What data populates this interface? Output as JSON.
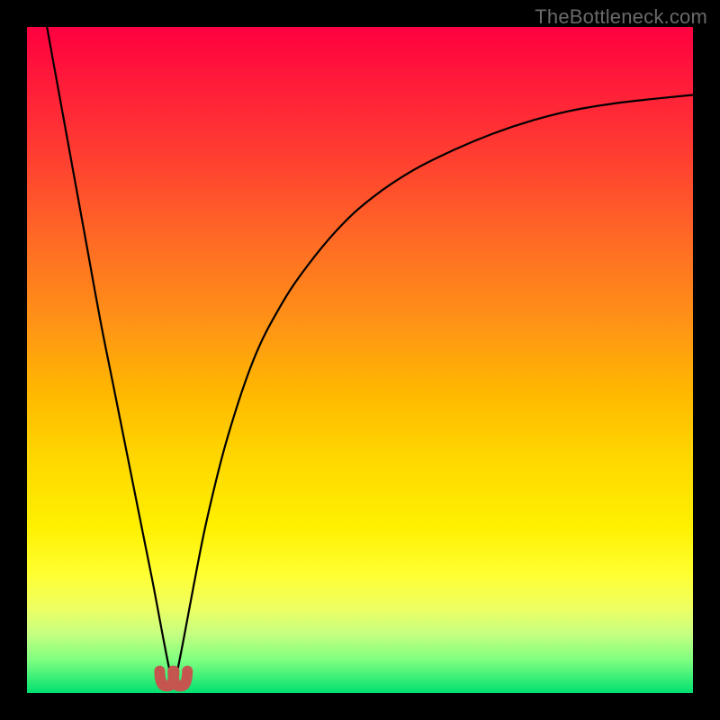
{
  "watermark": "TheBottleneck.com",
  "colors": {
    "frame": "#000000",
    "curve": "#000000",
    "marker_fill": "#c4564f",
    "marker_outline": "#c4564f"
  },
  "chart_data": {
    "type": "line",
    "title": "",
    "xlabel": "",
    "ylabel": "",
    "xlim": [
      0,
      100
    ],
    "ylim": [
      0,
      100
    ],
    "grid": false,
    "legend": false,
    "optimum_x": 22,
    "series": [
      {
        "name": "bottleneck-curve",
        "x": [
          3,
          5,
          7,
          9,
          11,
          13,
          15,
          17,
          19,
          20.5,
          21.5,
          22,
          22.5,
          23.5,
          25,
          27,
          30,
          34,
          38,
          42,
          47,
          52,
          58,
          64,
          70,
          76,
          82,
          88,
          94,
          100
        ],
        "y": [
          100,
          89,
          78,
          67,
          56,
          46,
          36,
          26,
          16,
          8,
          3,
          1.5,
          3,
          8,
          16,
          26,
          38,
          50,
          58,
          64,
          70,
          74.5,
          78.5,
          81.5,
          84,
          86,
          87.5,
          88.5,
          89.2,
          89.8
        ]
      }
    ],
    "markers": [
      {
        "name": "optimum-left",
        "x": 21,
        "y": 2.0
      },
      {
        "name": "optimum-right",
        "x": 23,
        "y": 2.0
      }
    ]
  }
}
